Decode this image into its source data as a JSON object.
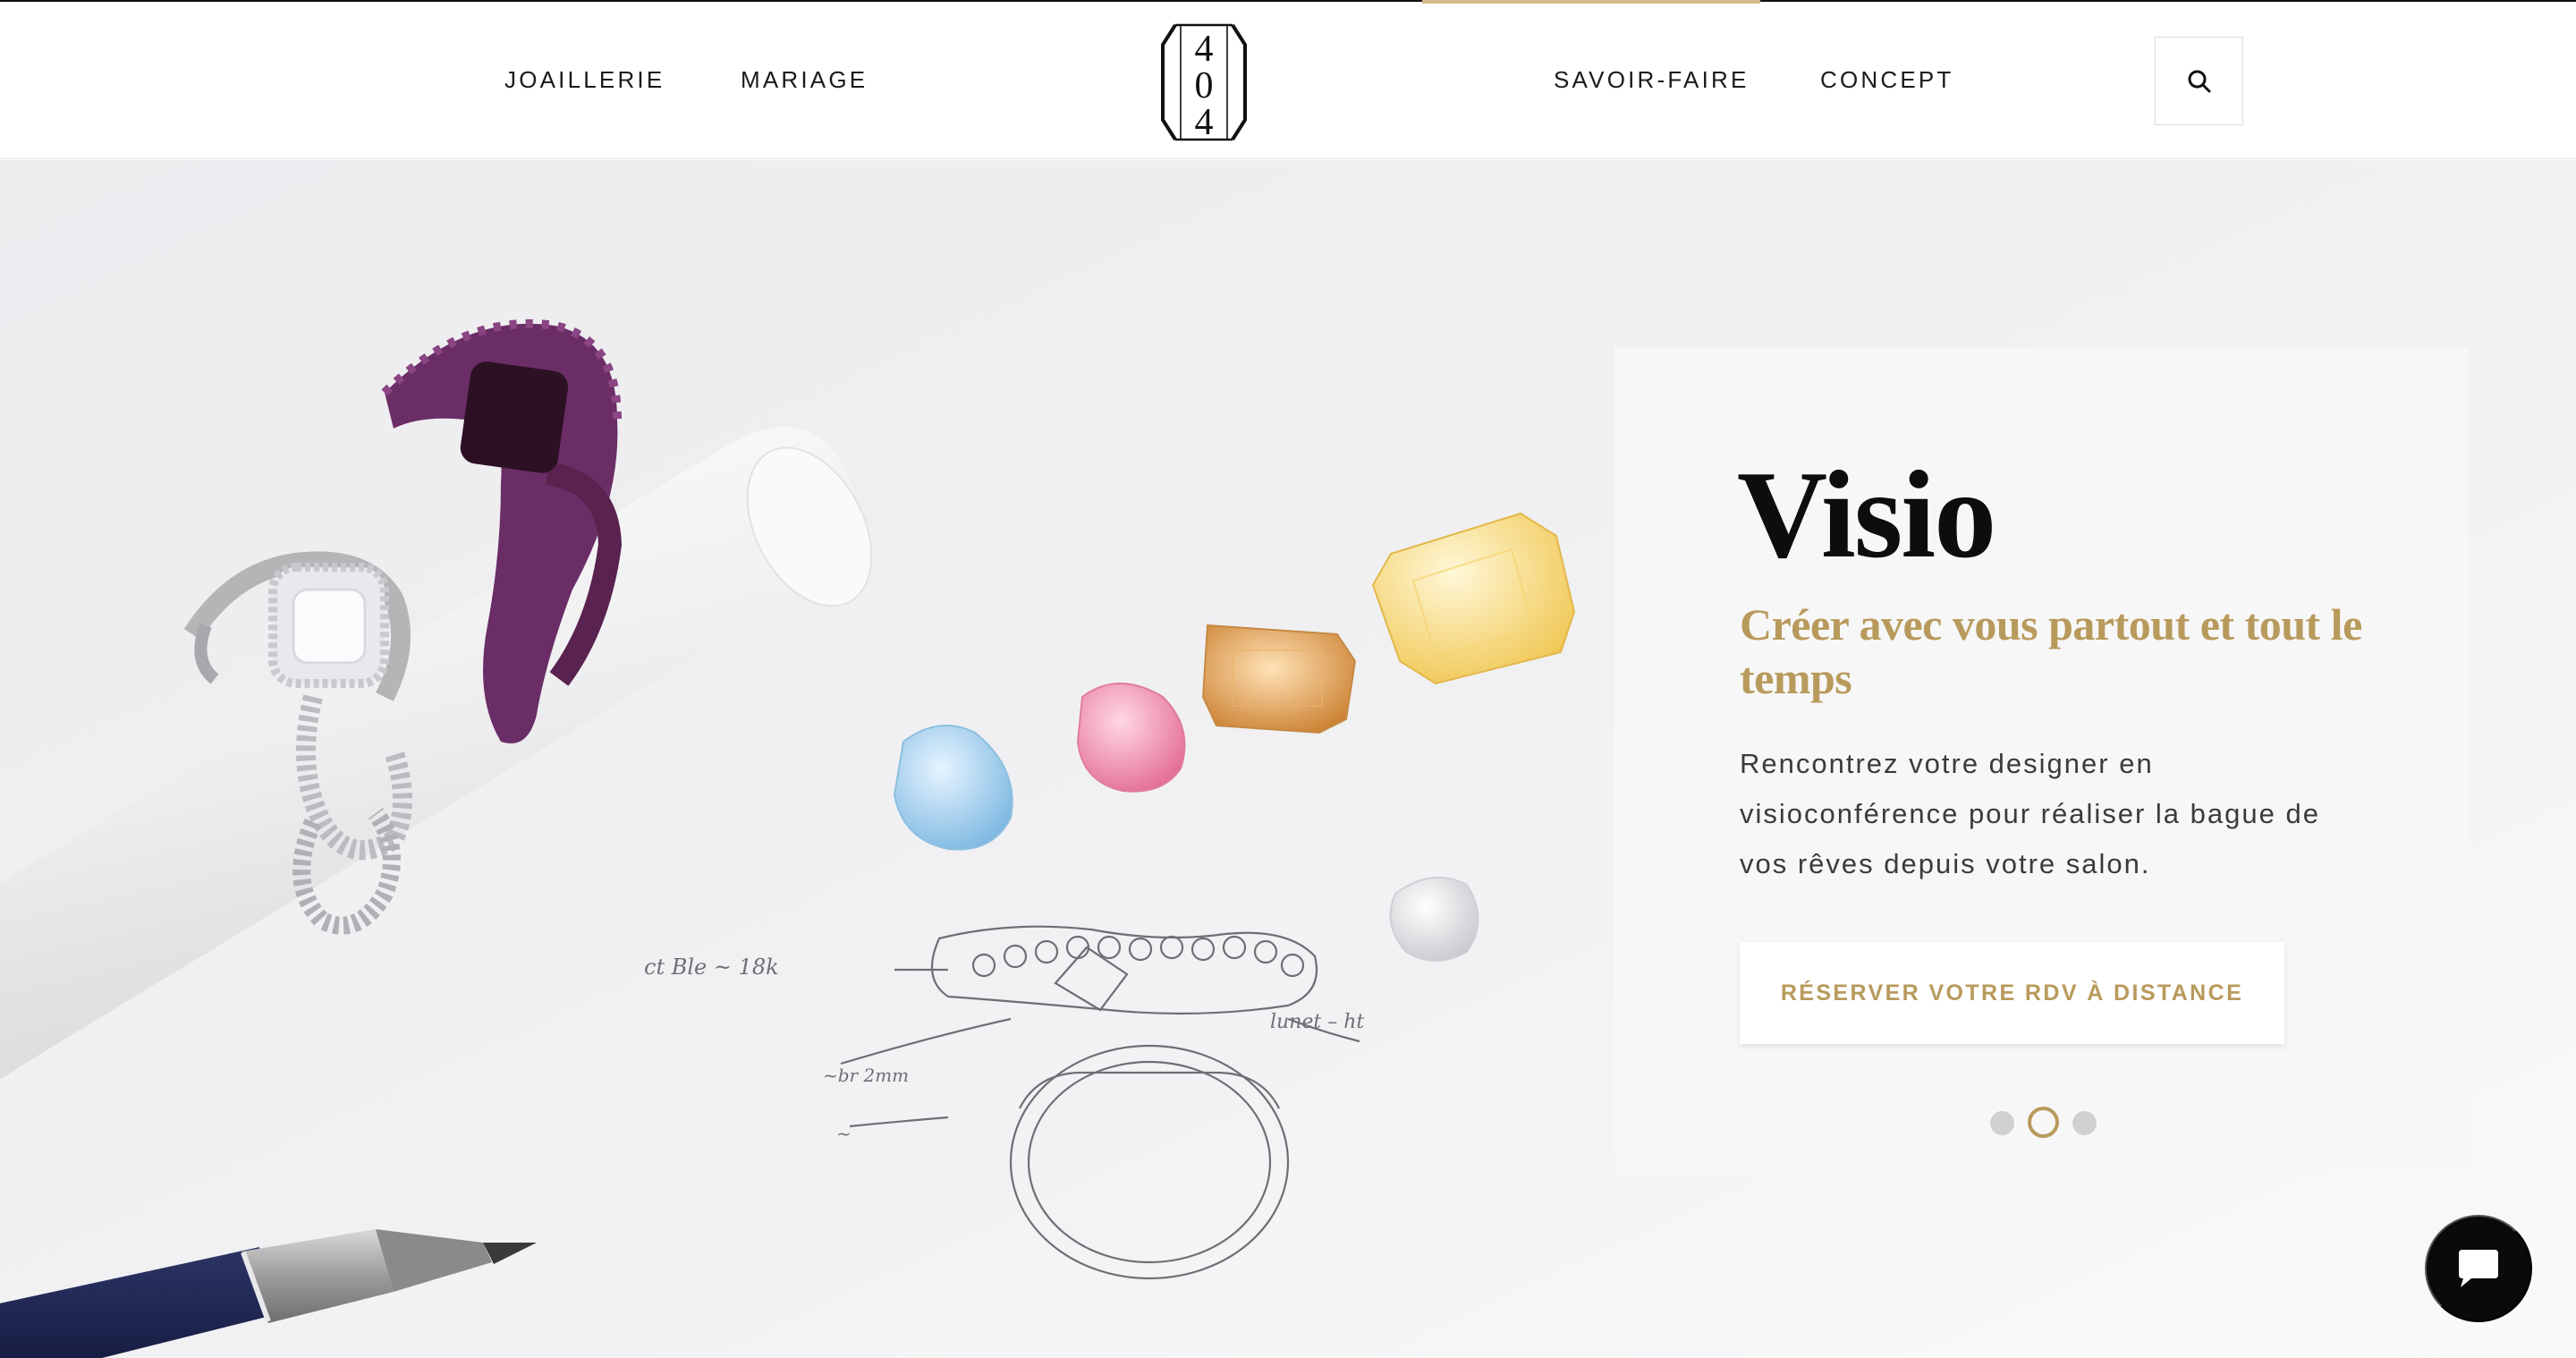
{
  "header": {
    "nav_left": [
      {
        "label": "JOAILLERIE"
      },
      {
        "label": "MARIAGE"
      }
    ],
    "nav_right": [
      {
        "label": "SAVOIR-FAIRE"
      },
      {
        "label": "CONCEPT"
      }
    ],
    "logo_text": "404",
    "search_icon": "search-icon"
  },
  "hero": {
    "title": "Visio",
    "subtitle": "Créer avec vous partout et tout le temps",
    "body": "Rencontrez votre designer en visioconférence pour réaliser la bague de vos rêves depuis votre salon.",
    "cta_label": "RÉSERVER VOTRE RDV À DISTANCE",
    "slides_total": 3,
    "active_slide": 2
  },
  "chat": {
    "icon": "chat-bubble-icon"
  },
  "colors": {
    "accent_gold": "#b89a5c",
    "header_accent": "#d4b98a",
    "text_dark": "#111111",
    "hero_bg": "#ececef"
  }
}
